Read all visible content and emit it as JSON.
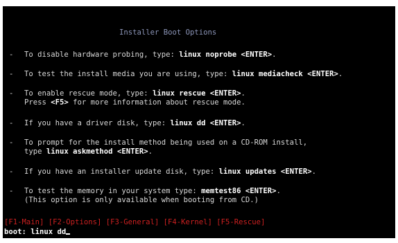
{
  "header": {
    "title": "Installer Boot Options"
  },
  "options": [
    {
      "bullet": "-",
      "line1_pre": "To disable hardware probing, type: ",
      "line1_cmd": "linux noprobe <ENTER>",
      "line1_post": "."
    },
    {
      "bullet": "-",
      "line1_pre": "To test the install media you are using, type: ",
      "line1_cmd": "linux mediacheck <ENTER>",
      "line1_post": "."
    },
    {
      "bullet": "-",
      "line1_pre": "To enable rescue mode, type: ",
      "line1_cmd": "linux rescue <ENTER>",
      "line1_post": ".",
      "line2_pre": "Press ",
      "line2_cmd": "<F5>",
      "line2_post": " for more information about rescue mode."
    },
    {
      "bullet": "-",
      "line1_pre": "If you have a driver disk, type: ",
      "line1_cmd": "linux dd <ENTER>",
      "line1_post": "."
    },
    {
      "bullet": "-",
      "line1_pre": "To prompt for the install method being used on a CD-ROM install,",
      "line1_cmd": "",
      "line1_post": "",
      "line2_pre": "type ",
      "line2_cmd": "linux askmethod <ENTER>",
      "line2_post": "."
    },
    {
      "bullet": "-",
      "line1_pre": "If you have an installer update disk, type: ",
      "line1_cmd": "linux updates <ENTER>",
      "line1_post": "."
    },
    {
      "bullet": "-",
      "line1_pre": "To test the memory in your system type: ",
      "line1_cmd": "memtest86 <ENTER>",
      "line1_post": ".",
      "line2_pre": "(This option is only available when booting from CD.)",
      "line2_cmd": "",
      "line2_post": ""
    }
  ],
  "function_keys": [
    "[F1-Main]",
    "[F2-Options]",
    "[F3-General]",
    "[F4-Kernel]",
    "[F5-Rescue]"
  ],
  "prompt": {
    "label": "boot: ",
    "value": "linux dd"
  },
  "colors": {
    "background": "#000000",
    "text": "#d8d8d8",
    "header": "#8c95b8",
    "function_keys": "#cc2020"
  }
}
